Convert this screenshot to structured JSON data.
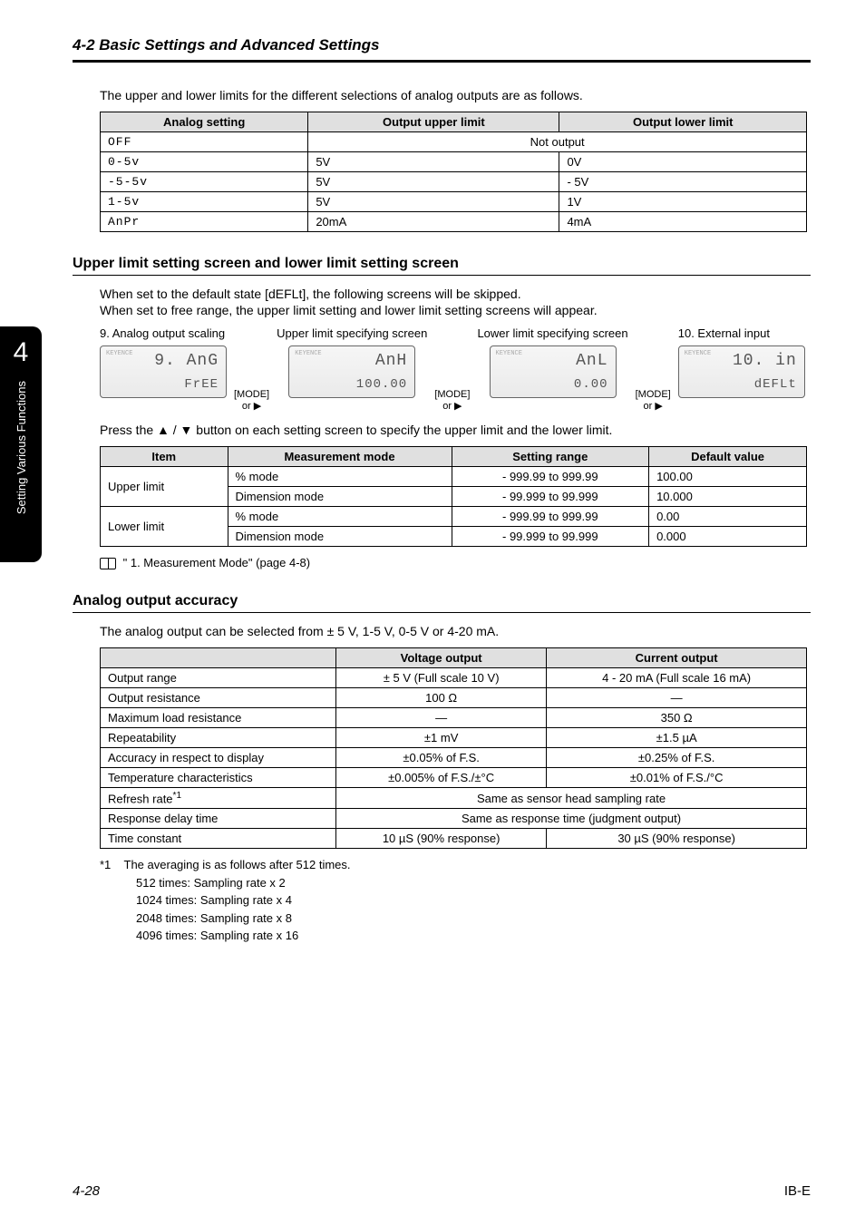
{
  "header": {
    "section_title": "4-2  Basic Settings and Advanced Settings"
  },
  "sidetab": {
    "num": "4",
    "text": "Setting Various Functions"
  },
  "intro1": "The upper and lower limits for the different selections of analog outputs are as follows.",
  "table1": {
    "headers": [
      "Analog setting",
      "Output upper limit",
      "Output lower limit"
    ],
    "rows": [
      {
        "setting": "OFF",
        "upper": "Not output",
        "lower": "Not output",
        "merged": true
      },
      {
        "setting": "0-5v",
        "upper": "5V",
        "lower": "0V"
      },
      {
        "setting": "-5-5v",
        "upper": "5V",
        "lower": "- 5V"
      },
      {
        "setting": "1-5v",
        "upper": "5V",
        "lower": "1V"
      },
      {
        "setting": "AnPr",
        "upper": "20mA",
        "lower": "4mA"
      }
    ]
  },
  "subhead1": "Upper limit setting screen and lower limit setting screen",
  "para1a": "When set to the default state [dEFLt], the following screens will be skipped.",
  "para1b": "When set to free range, the upper limit setting and lower limit setting screens will appear.",
  "screens": {
    "col1": {
      "title": "9. Analog output scaling",
      "big": "9. AnG",
      "small": "FrEE"
    },
    "arrow_label": "[MODE]",
    "arrow_sub": "or ▶",
    "col2": {
      "title": "Upper limit specifying screen",
      "big": "AnH",
      "small": "100.00"
    },
    "col3": {
      "title": "Lower limit specifying screen",
      "big": "AnL",
      "small": "0.00"
    },
    "col4": {
      "title": "10. External input",
      "big": "10. in",
      "small": "dEFLt"
    }
  },
  "para2": "Press the ▲ / ▼ button on each setting screen to specify the upper limit and the lower limit.",
  "table2": {
    "headers": [
      "Item",
      "Measurement mode",
      "Setting range",
      "Default value"
    ],
    "rows": [
      {
        "item": "Upper limit",
        "mode": "% mode",
        "range": "- 999.99 to 999.99",
        "default": "100.00"
      },
      {
        "item": "",
        "mode": "Dimension mode",
        "range": "- 99.999 to 99.999",
        "default": "10.000"
      },
      {
        "item": "Lower limit",
        "mode": "% mode",
        "range": "- 999.99 to 999.99",
        "default": "0.00"
      },
      {
        "item": "",
        "mode": "Dimension mode",
        "range": "- 99.999 to 99.999",
        "default": "0.000"
      }
    ]
  },
  "ref1": "\" 1. Measurement Mode\" (page 4-8)",
  "subhead2": "Analog output accuracy",
  "para3": "The analog output can be selected from ± 5 V, 1-5 V, 0-5 V or 4-20 mA.",
  "table3": {
    "headers": [
      "",
      "Voltage output",
      "Current output"
    ],
    "rows": [
      {
        "label": "Output range",
        "v": "± 5 V (Full scale 10 V)",
        "c": "4 - 20 mA (Full scale 16 mA)"
      },
      {
        "label": "Output resistance",
        "v": "100 Ω",
        "c": "—"
      },
      {
        "label": "Maximum load resistance",
        "v": "—",
        "c": "350 Ω"
      },
      {
        "label": "Repeatability",
        "v": "±1 mV",
        "c": "±1.5 µA"
      },
      {
        "label": "Accuracy in respect to display",
        "v": "±0.05% of F.S.",
        "c": "±0.25% of F.S."
      },
      {
        "label": "Temperature characteristics",
        "v": "±0.005% of F.S./±°C",
        "c": "±0.01% of F.S./°C"
      },
      {
        "label": "Refresh rate",
        "sup": "*1",
        "merged": "Same as sensor head sampling rate"
      },
      {
        "label": "Response delay time",
        "merged": "Same as response time (judgment output)"
      },
      {
        "label": "Time constant",
        "v": "10 µS (90% response)",
        "c": "30 µS (90% response)"
      }
    ]
  },
  "note": {
    "lead": "*1",
    "line1": "The averaging is as follows after 512 times.",
    "l2": "512 times: Sampling rate x 2",
    "l3": "1024 times: Sampling rate x 4",
    "l4": "2048 times: Sampling rate x 8",
    "l5": "4096 times: Sampling rate x 16"
  },
  "footer": {
    "page": "4-28",
    "doc": "IB-E"
  }
}
